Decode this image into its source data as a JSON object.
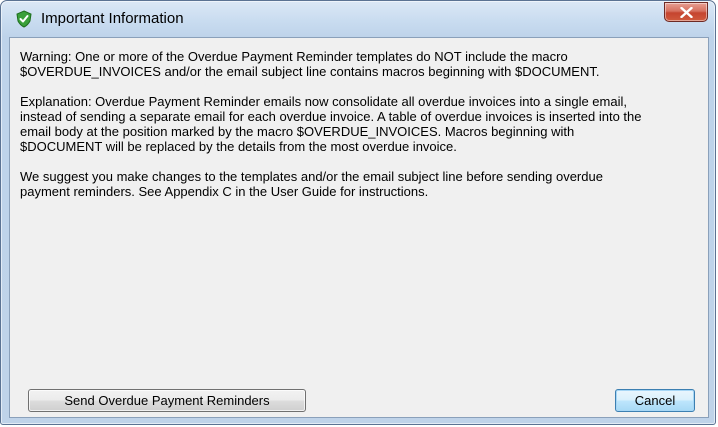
{
  "window": {
    "title": "Important Information",
    "app_icon": "green-shield-check-icon",
    "close_icon": "close-x-icon"
  },
  "message": {
    "warning": "Warning: One or more of the Overdue Payment Reminder templates do NOT include the macro\n$OVERDUE_INVOICES and/or the email subject line contains macros beginning with $DOCUMENT.",
    "explanation": "Explanation: Overdue Payment Reminder emails now consolidate all overdue invoices into a single email,\ninstead of sending a separate email for each overdue invoice. A table of overdue invoices is inserted into the\nemail body at the position marked by the macro $OVERDUE_INVOICES. Macros beginning with\n$DOCUMENT will be replaced by the details from the most overdue invoice.",
    "suggestion": "We suggest you make changes to the templates and/or the email subject line before sending overdue\npayment reminders. See Appendix C in the User Guide for instructions."
  },
  "buttons": {
    "send_label": "Send Overdue Payment Reminders",
    "cancel_label": "Cancel"
  },
  "colors": {
    "close_button": "#c5442f",
    "icon_green": "#3aa03a",
    "client_background": "#f0f0f0"
  }
}
